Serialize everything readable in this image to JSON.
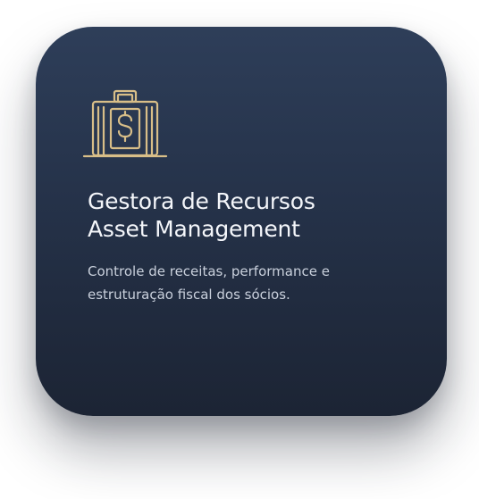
{
  "card": {
    "icon": "briefcase-dollar-icon",
    "title_line1": "Gestora de Recursos",
    "title_line2": "Asset Management",
    "description_line1": "Controle de receitas, performance e",
    "description_line2": "estruturação fiscal dos sócios."
  },
  "colors": {
    "card_top": "#2e3e59",
    "card_bottom": "#1c2434",
    "icon_gold": "#d8be88",
    "title": "#f4f6fa",
    "description": "#c9d0dc"
  }
}
